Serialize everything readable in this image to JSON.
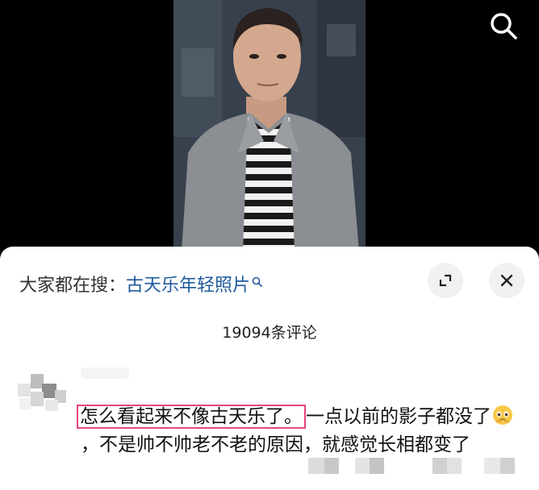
{
  "header": {
    "search_icon": "search-icon"
  },
  "sheet": {
    "hot_search_prefix": "大家都在搜：",
    "hot_search_term": "古天乐年轻照片",
    "expand_icon": "expand-icon",
    "close_icon": "close-icon",
    "comment_count": "19094条评论"
  },
  "comment": {
    "highlighted": "怎么看起来不像古天乐了。",
    "text_part1": "一点以前的影子都没了",
    "emoji": "pleading-face-emoji",
    "text_part2": "，不是帅不帅老不老的原因，就感觉长相都变了"
  },
  "colors": {
    "highlight_border": "#e8457a",
    "link_blue": "#1f5a9e"
  }
}
